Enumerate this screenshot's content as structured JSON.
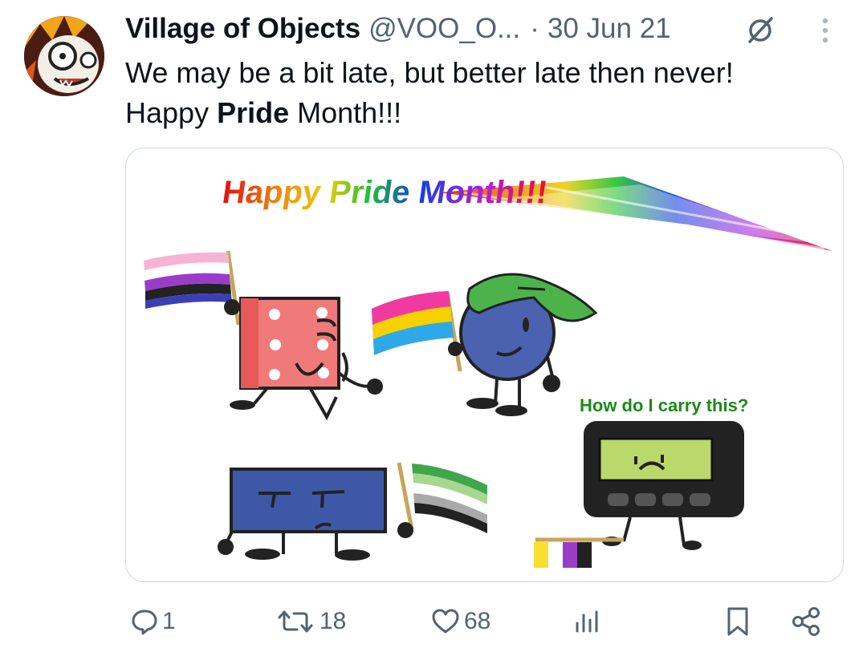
{
  "tweet": {
    "author_name": "Village of Objects",
    "author_handle": "@VOO_O...",
    "separator": "·",
    "date": "30 Jun 21",
    "text_line1": "We may be a bit late, but better late then never!",
    "text_line2_prefix": "Happy ",
    "text_line2_bold": "Pride",
    "text_line2_suffix": " Month!!!"
  },
  "media": {
    "banner_text": "Happy Pride Month!!!",
    "caption": "How do I carry this?"
  },
  "actions": {
    "replies": "1",
    "reposts": "18",
    "likes": "68"
  },
  "icons": {
    "verified_circle": "circle-slash-icon",
    "more": "more-vertical-icon",
    "reply": "speech-bubble-icon",
    "repost": "repost-arrows-icon",
    "like": "heart-icon",
    "views": "bar-chart-icon",
    "bookmark": "bookmark-icon",
    "share": "share-nodes-icon"
  },
  "colors": {
    "text": "#0f1419",
    "muted": "#536471",
    "caption_green": "#1a8a1a",
    "border": "#cfd9de"
  }
}
